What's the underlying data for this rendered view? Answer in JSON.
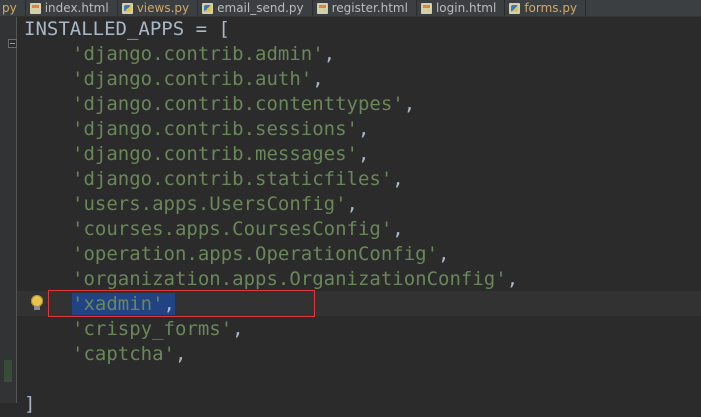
{
  "tabs": [
    {
      "label": "py",
      "type": "py"
    },
    {
      "label": "index.html",
      "type": "html"
    },
    {
      "label": "views.py",
      "type": "py"
    },
    {
      "label": "email_send.py",
      "type": "py"
    },
    {
      "label": "register.html",
      "type": "html"
    },
    {
      "label": "login.html",
      "type": "html"
    },
    {
      "label": "forms.py",
      "type": "py"
    }
  ],
  "code": {
    "header": "INSTALLED_APPS = [",
    "items": [
      "'django.contrib.admin'",
      "'django.contrib.auth'",
      "'django.contrib.contenttypes'",
      "'django.contrib.sessions'",
      "'django.contrib.messages'",
      "'django.contrib.staticfiles'",
      "'users.apps.UsersConfig'",
      "'courses.apps.CoursesConfig'",
      "'operation.apps.OperationConfig'",
      "'organization.apps.OrganizationConfig'",
      "'xadmin'",
      "'crispy_forms'",
      "'captcha'"
    ],
    "separator": ",",
    "closing": "]"
  },
  "colors": {
    "background": "#2b2b2b",
    "string": "#6a8759",
    "default_text": "#a9b7c6",
    "selection": "#214283",
    "annotation_box": "#e0383d",
    "py_tab_text": "#d1a86a"
  },
  "icons": {
    "intention_bulb": "lightbulb-icon",
    "fold": "fold-icon"
  }
}
